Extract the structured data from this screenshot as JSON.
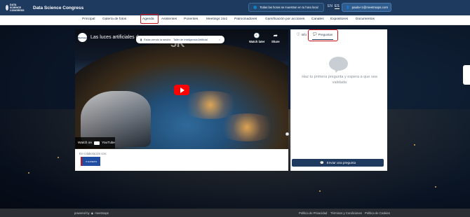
{
  "header": {
    "logo_text": "DATA SCIENCE CONGRESS",
    "title": "Data Science Congress",
    "timezone_notice": "Todas las horas se muestran en tu hora local",
    "lang_en": "EN",
    "lang_es": "ES",
    "user_email": "paula+1@meetmaps.com"
  },
  "nav": {
    "items": [
      "Principal",
      "Galería de fotos",
      "Agenda",
      "Asistentes",
      "Ponentes",
      "Meetings 1to1",
      "Patrocinadores",
      "Gamificación por acciones",
      "Canales",
      "Expositores",
      "Documentos"
    ]
  },
  "video": {
    "channel_avatar": "Meetmaps",
    "title": "Las luces artificiales de n",
    "overlay_text": "5K",
    "watch_later": "Watch later",
    "share": "Share",
    "watch_on": "Watch on",
    "youtube": "YouTube"
  },
  "toast": {
    "prefix": "Estás viendo la sesión:",
    "session": "Taller de Inteligencia Artificial",
    "close": "×"
  },
  "collab": {
    "label": "En colaboración con:",
    "logo_text": "IT EXPERTS"
  },
  "panel": {
    "tab_info": "Info",
    "tab_questions": "Preguntas",
    "empty_text": "Haz tu primera pregunta y espera a que sea validada",
    "send_button": "Enviar una pregunta"
  },
  "footer": {
    "powered_by": "powered by",
    "brand": "meetmaps",
    "privacy": "Política de Privacidad",
    "terms": "Términos y Condiciones",
    "cookies": "Política de Cookies"
  },
  "colors": {
    "primary": "#1e3a5f",
    "highlight": "#d0121c",
    "youtube_red": "#ff0000"
  }
}
